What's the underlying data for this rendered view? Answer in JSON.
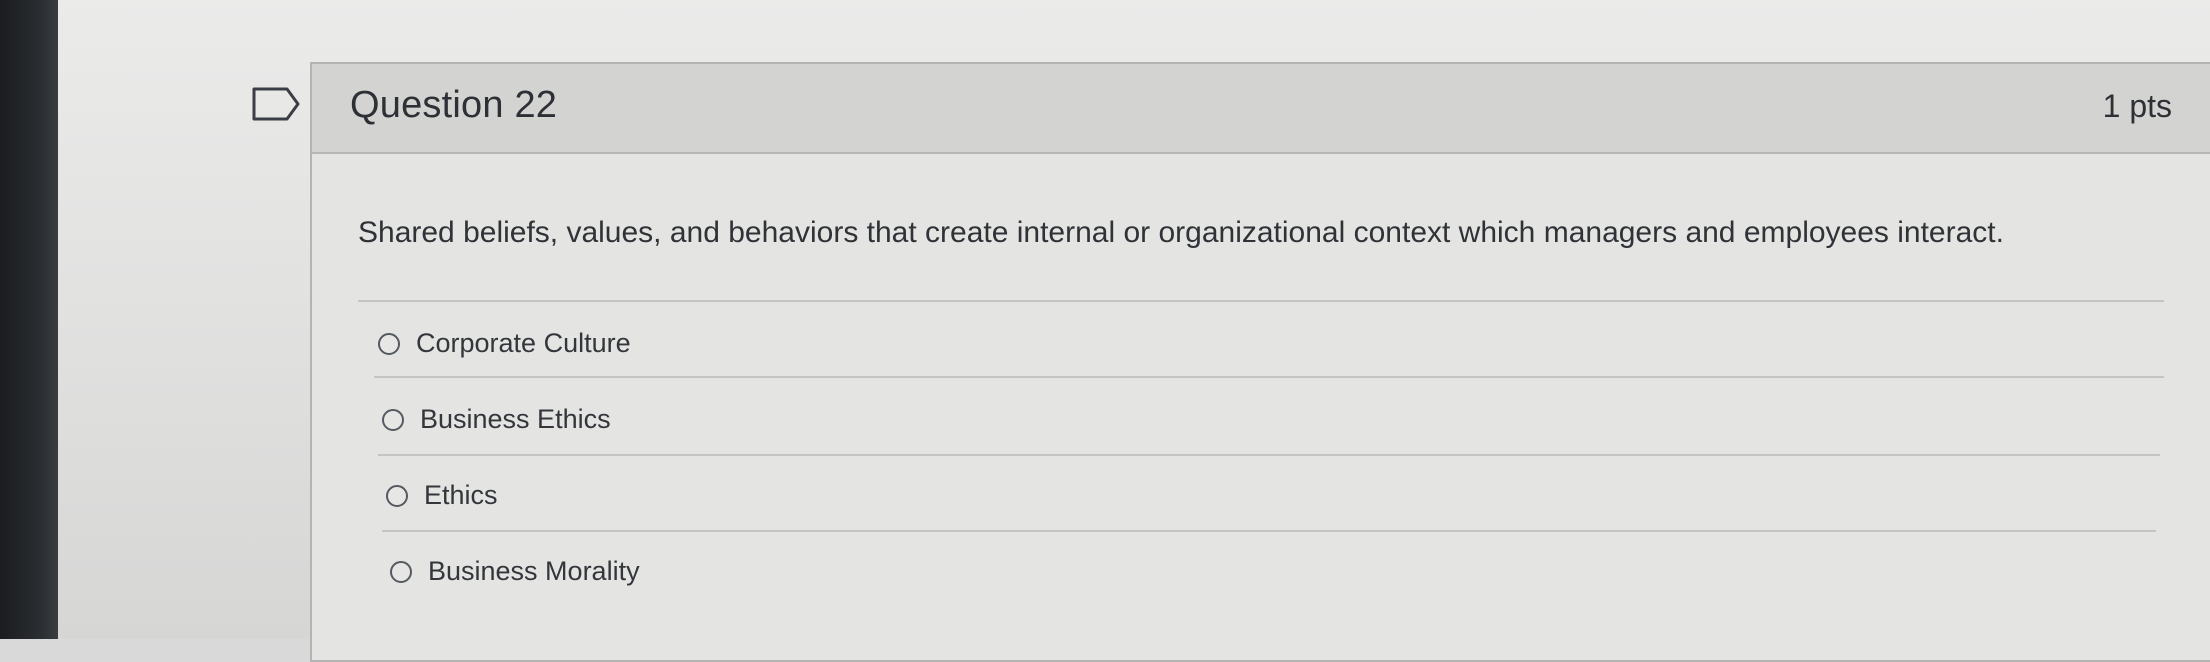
{
  "question": {
    "title": "Question 22",
    "points": "1 pts",
    "text": "Shared beliefs, values, and behaviors that create internal or organizational context which managers and employees interact."
  },
  "answers": [
    {
      "label": "Corporate Culture"
    },
    {
      "label": "Business Ethics"
    },
    {
      "label": "Ethics"
    },
    {
      "label": "Business Morality"
    }
  ],
  "icons": {
    "flag": "bookmark-flag-icon",
    "radio": "radio-unselected-icon"
  },
  "colors": {
    "header_bg": "#d3d3d2",
    "card_border": "#b4b4b4",
    "text": "#2d3035"
  }
}
